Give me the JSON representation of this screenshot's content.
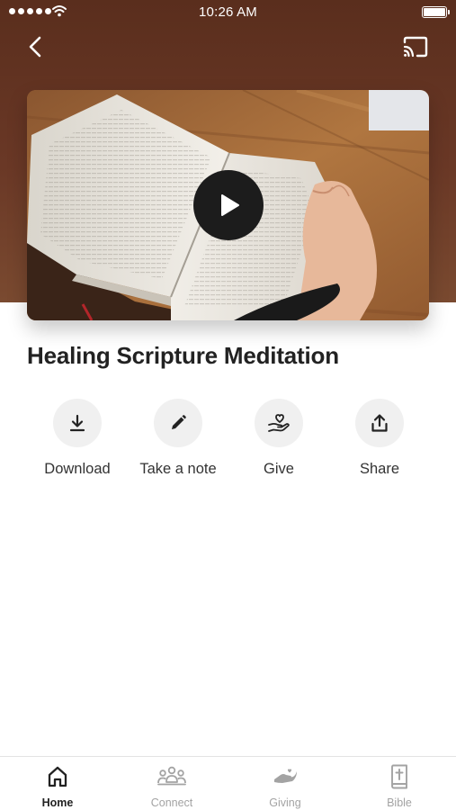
{
  "status_bar": {
    "time": "10:26 AM"
  },
  "media": {
    "title": "Healing Scripture Meditation"
  },
  "actions": [
    {
      "label": "Download",
      "icon": "download-icon"
    },
    {
      "label": "Take a note",
      "icon": "pencil-icon"
    },
    {
      "label": "Give",
      "icon": "heart-hand-icon"
    },
    {
      "label": "Share",
      "icon": "share-icon"
    }
  ],
  "tab_bar": {
    "tabs": [
      {
        "label": "Home",
        "icon": "home-icon",
        "active": true
      },
      {
        "label": "Connect",
        "icon": "people-icon",
        "active": false
      },
      {
        "label": "Giving",
        "icon": "giving-hand-icon",
        "active": false
      },
      {
        "label": "Bible",
        "icon": "bible-icon",
        "active": false
      }
    ]
  },
  "colors": {
    "header_brown": "#5a2e1d",
    "play_button": "#1c1c1c",
    "action_circle": "#f0f0f0",
    "active_tab": "#222222",
    "inactive_tab": "#a3a3a3"
  }
}
